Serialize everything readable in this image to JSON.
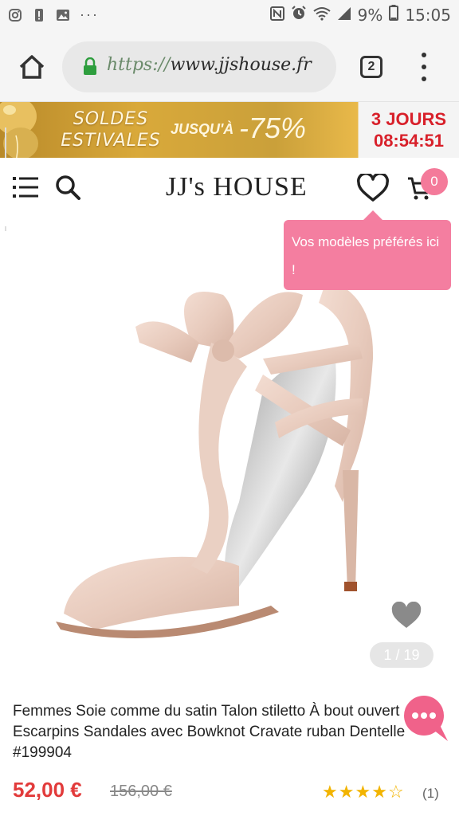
{
  "status_bar": {
    "battery": "9%",
    "time": "15:05",
    "more": "···"
  },
  "browser": {
    "url_scheme": "https://",
    "url_host": "www.jjshouse.fr",
    "tab_count": "2"
  },
  "promo": {
    "line1": "SOLDES",
    "line2": "ESTIVALES",
    "upto": "JUSQU'À",
    "discount": "-75%",
    "countdown_days": "3 JOURS",
    "countdown_time": "08:54:51"
  },
  "header": {
    "logo": "JJ's HOUSE",
    "cart_count": "0"
  },
  "tooltip": {
    "text": "Vos modèles préférés ici !"
  },
  "gallery": {
    "counter": "1 / 19"
  },
  "product": {
    "title": "Femmes Soie comme du satin Talon stiletto À bout ouvert Escarpins Sandales avec Bowknot Cravate ruban Dentelle #199904",
    "price": "52,00 €",
    "old_price": "156,00 €",
    "rating": 4,
    "review_count": "(1)"
  },
  "colors": {
    "accent_pink": "#f47ea0",
    "price_red": "#e23b3b",
    "star_gold": "#f2b400",
    "countdown_red": "#d8202a"
  }
}
